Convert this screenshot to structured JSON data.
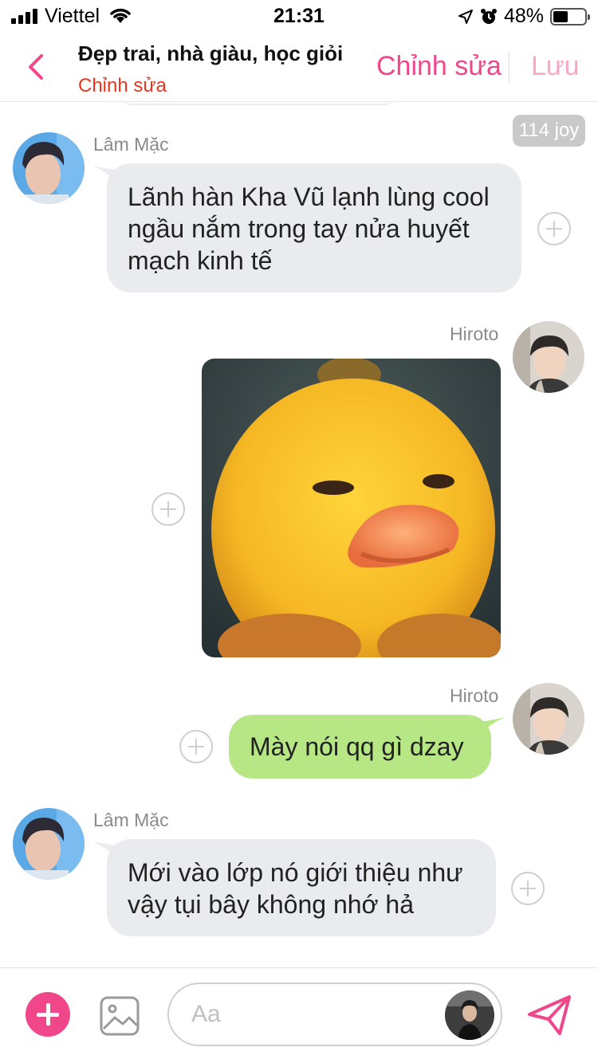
{
  "status_bar": {
    "carrier": "Viettel",
    "time": "21:31",
    "battery": "48%",
    "battery_level": 0.48
  },
  "header": {
    "title": "Đẹp trai, nhà giàu, học giỏi",
    "subtitle": "Chỉnh sửa",
    "edit_label": "Chỉnh sửa",
    "save_label": "Lưu"
  },
  "chat": {
    "joy_badge": "114 joy",
    "messages": [
      {
        "sender": "Lâm Mặc",
        "side": "left",
        "text": "Lãnh hàn Kha Vũ lạnh lùng cool ngầu nắm trong tay nửa huyết mạch kinh tế"
      },
      {
        "sender": "Hiroto",
        "side": "right",
        "type": "image",
        "image": "yellow-duck-sticker"
      },
      {
        "sender": "Hiroto",
        "side": "right",
        "text": "Mày nói qq gì dzay"
      },
      {
        "sender": "Lâm Mặc",
        "side": "left",
        "text": "Mới vào lớp nó giới thiệu như vậy tụi bây không nhớ hả"
      }
    ]
  },
  "composer": {
    "placeholder": "Aa"
  },
  "colors": {
    "accent": "#f0478a",
    "accent_light": "#f6a8c6",
    "subtitle_red": "#e8351e",
    "bubble_gray": "#e9ebee",
    "bubble_green": "#b6e784"
  },
  "icons": [
    "signal-icon",
    "wifi-icon",
    "location-icon",
    "alarm-icon",
    "battery-icon",
    "back-chevron-icon",
    "plus-circle-icon",
    "image-icon",
    "send-icon",
    "add-icon"
  ]
}
